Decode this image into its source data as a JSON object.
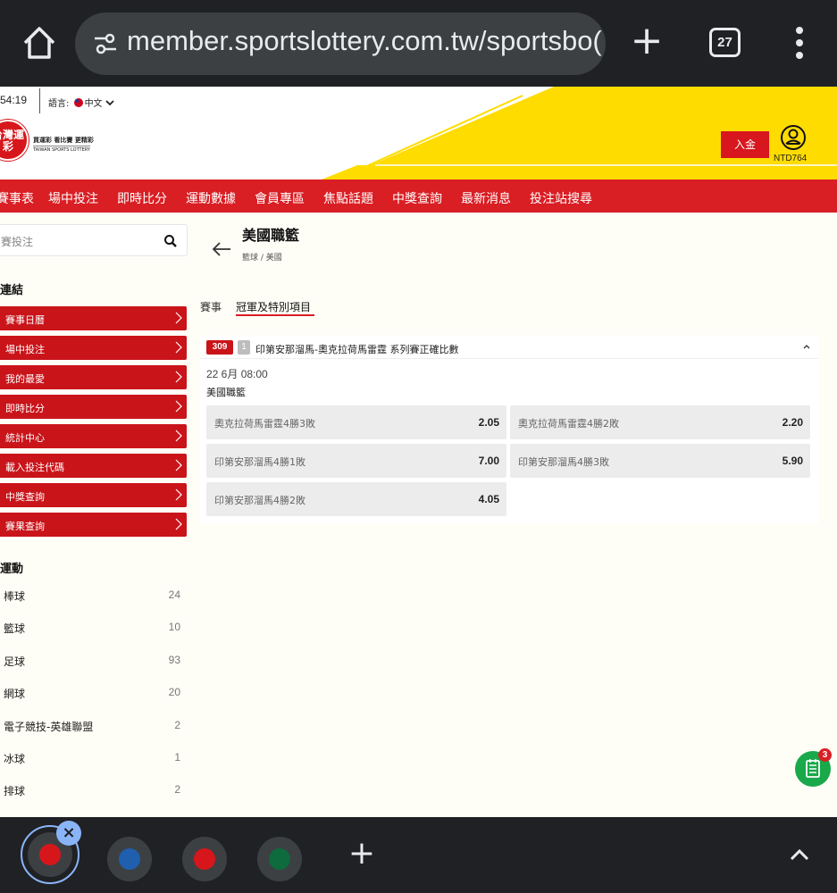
{
  "browser": {
    "url": "member.sportslottery.com.tw/sportsbo(",
    "tab_count": "27"
  },
  "header": {
    "time": "54:19",
    "language_label": "語言:",
    "language_value": "中文",
    "logo_text": "台灣運彩",
    "logo_slogan_zh": "買運彩 看比賽 更精彩",
    "logo_slogan_en": "TAIWAN SPORTS LOTTERY",
    "deposit_label": "入金",
    "balance": "NTD764",
    "accent_color": "#d91e24",
    "deco_color": "#ffdc00"
  },
  "nav": {
    "items": [
      "賽事表",
      "場中投注",
      "即時比分",
      "運動數據",
      "會員專區",
      "焦點話題",
      "中獎查詢",
      "最新消息",
      "投注站搜尋"
    ]
  },
  "sidebar": {
    "search_placeholder": "賽投注",
    "links_heading": "連結",
    "links": [
      "賽事日曆",
      "場中投注",
      "我的最愛",
      "即時比分",
      "統計中心",
      "載入投注代碼",
      "中獎查詢",
      "賽果查詢"
    ],
    "sports_heading": "運動",
    "sports": [
      {
        "name": "棒球",
        "count": "24"
      },
      {
        "name": "籃球",
        "count": "10"
      },
      {
        "name": "足球",
        "count": "93"
      },
      {
        "name": "網球",
        "count": "20"
      },
      {
        "name": "電子競技-英雄聯盟",
        "count": "2"
      },
      {
        "name": "冰球",
        "count": "1"
      },
      {
        "name": "排球",
        "count": "2"
      }
    ]
  },
  "main": {
    "title": "美國職籃",
    "breadcrumb": "籃球 / 美國",
    "tabs": [
      "賽事",
      "冠軍及特別項目"
    ],
    "market": {
      "code": "309",
      "index": "1",
      "title": "印第安那溜馬-奧克拉荷馬雷霆 系列賽正確比數",
      "date": "22 6月  08:00",
      "league": "美國職籃",
      "odds": [
        {
          "label": "奧克拉荷馬雷霆4勝3敗",
          "value": "2.05"
        },
        {
          "label": "奧克拉荷馬雷霆4勝2敗",
          "value": "2.20"
        },
        {
          "label": "印第安那溜馬4勝1敗",
          "value": "7.00"
        },
        {
          "label": "印第安那溜馬4勝3敗",
          "value": "5.90"
        },
        {
          "label": "印第安那溜馬4勝2敗",
          "value": "4.05"
        }
      ]
    },
    "floating_badge": "3"
  }
}
